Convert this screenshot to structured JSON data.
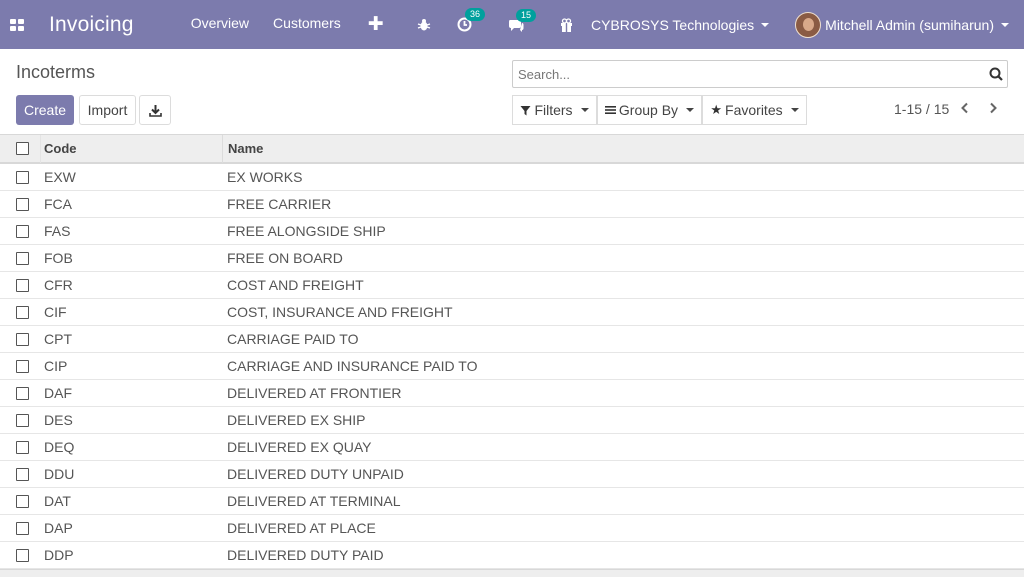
{
  "navbar": {
    "app_name": "Invoicing",
    "menu": [
      "Overview",
      "Customers"
    ],
    "activity_count": "36",
    "messages_count": "15",
    "company": "CYBROSYS Technologies",
    "user": "Mitchell Admin (sumiharun)"
  },
  "control_panel": {
    "title": "Incoterms",
    "create_label": "Create",
    "import_label": "Import",
    "search_placeholder": "Search...",
    "filters_label": "Filters",
    "groupby_label": "Group By",
    "favorites_label": "Favorites",
    "pager": "1-15 / 15"
  },
  "table": {
    "columns": [
      "Code",
      "Name"
    ],
    "rows": [
      {
        "code": "EXW",
        "name": "EX WORKS"
      },
      {
        "code": "FCA",
        "name": "FREE CARRIER"
      },
      {
        "code": "FAS",
        "name": "FREE ALONGSIDE SHIP"
      },
      {
        "code": "FOB",
        "name": "FREE ON BOARD"
      },
      {
        "code": "CFR",
        "name": "COST AND FREIGHT"
      },
      {
        "code": "CIF",
        "name": "COST, INSURANCE AND FREIGHT"
      },
      {
        "code": "CPT",
        "name": "CARRIAGE PAID TO"
      },
      {
        "code": "CIP",
        "name": "CARRIAGE AND INSURANCE PAID TO"
      },
      {
        "code": "DAF",
        "name": "DELIVERED AT FRONTIER"
      },
      {
        "code": "DES",
        "name": "DELIVERED EX SHIP"
      },
      {
        "code": "DEQ",
        "name": "DELIVERED EX QUAY"
      },
      {
        "code": "DDU",
        "name": "DELIVERED DUTY UNPAID"
      },
      {
        "code": "DAT",
        "name": "DELIVERED AT TERMINAL"
      },
      {
        "code": "DAP",
        "name": "DELIVERED AT PLACE"
      },
      {
        "code": "DDP",
        "name": "DELIVERED DUTY PAID"
      }
    ]
  },
  "colors": {
    "brand": "#7c7bad",
    "badge": "#00a09d"
  },
  "icons": [
    "apps-icon",
    "plus-icon",
    "bug-icon",
    "activity-icon",
    "messages-icon",
    "gift-icon",
    "search-icon",
    "download-icon",
    "filter-icon",
    "list-icon",
    "star-icon",
    "chevron-left-icon",
    "chevron-right-icon"
  ]
}
